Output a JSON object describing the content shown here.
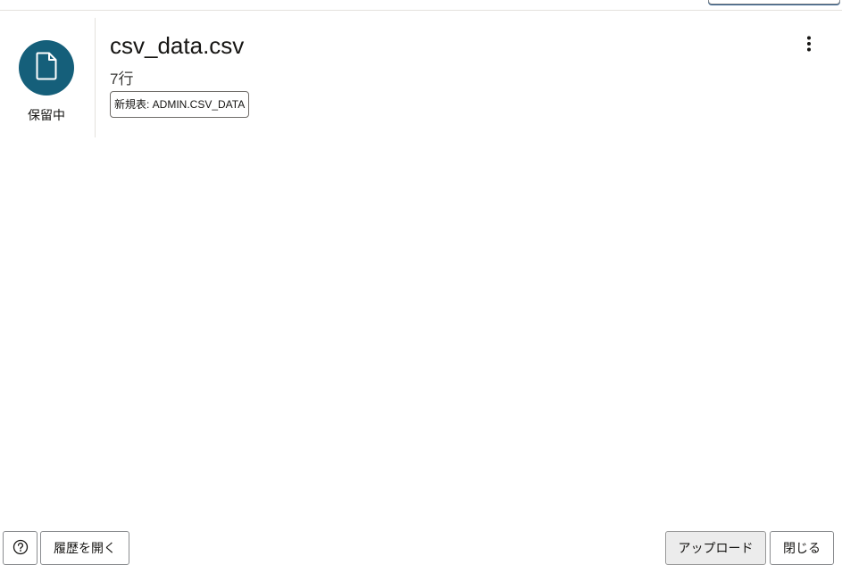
{
  "file": {
    "name": "csv_data.csv",
    "row_count": "7行",
    "status": "保留中",
    "target_table_badge": "新規表: ADMIN.CSV_DATA",
    "status_icon": "document-icon",
    "status_color": "#155f7a"
  },
  "actions": {
    "more_icon": "more-vertical-icon"
  },
  "footer": {
    "help_icon": "help-circle-icon",
    "history_label": "履歴を開く",
    "upload_label": "アップロード",
    "close_label": "閉じる"
  }
}
